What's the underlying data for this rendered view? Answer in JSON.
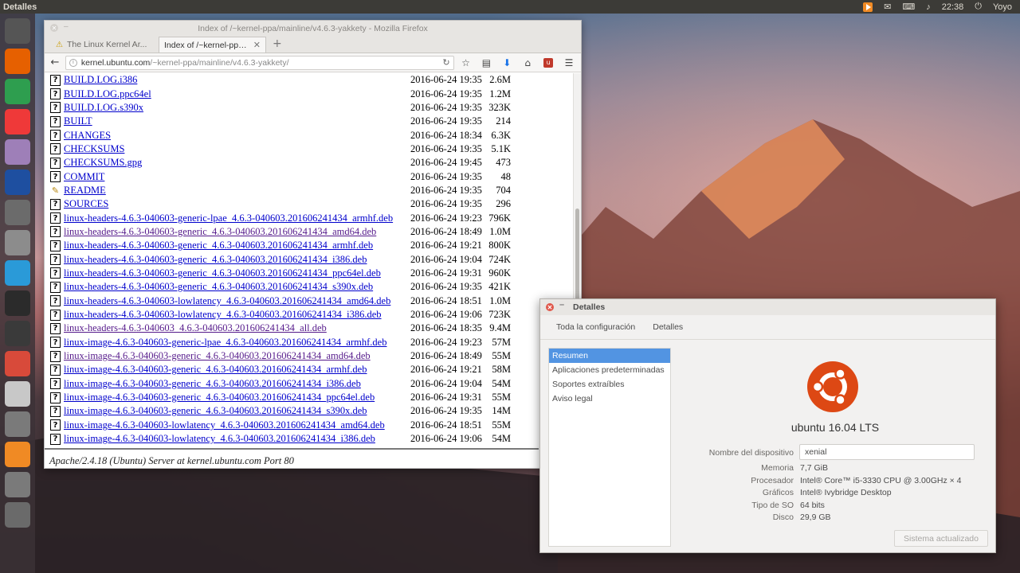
{
  "top_panel": {
    "title": "Detalles",
    "time": "22:38",
    "user": "Yoyo"
  },
  "launcher": {
    "items": [
      {
        "name": "ubuntu-dash",
        "color": "#555555"
      },
      {
        "name": "firefox",
        "color": "#e66000"
      },
      {
        "name": "chrome",
        "color": "#2e9e4f"
      },
      {
        "name": "vivaldi",
        "color": "#ef3939"
      },
      {
        "name": "files",
        "color": "#9e7fb8"
      },
      {
        "name": "audacity",
        "color": "#1e4fa0"
      },
      {
        "name": "terminal-app",
        "color": "#6b6b6b"
      },
      {
        "name": "archive",
        "color": "#8c8c8c"
      },
      {
        "name": "deepin",
        "color": "#2a9ad8"
      },
      {
        "name": "terminal",
        "color": "#2b2b2b"
      },
      {
        "name": "obs",
        "color": "#3a3a3a"
      },
      {
        "name": "downloader",
        "color": "#d84a3a"
      },
      {
        "name": "utility",
        "color": "#c8c8c8"
      },
      {
        "name": "settings",
        "color": "#7a7a7a"
      },
      {
        "name": "vlc",
        "color": "#f08a24"
      },
      {
        "name": "system-settings",
        "color": "#7a7a7a"
      },
      {
        "name": "drive",
        "color": "#6a6a6a"
      }
    ]
  },
  "firefox": {
    "window_title": "Index of /~kernel-ppa/mainline/v4.6.3-yakkety - Mozilla Firefox",
    "tabs": [
      {
        "label": "The Linux Kernel Ar..."
      },
      {
        "label": "Index of /~kernel-ppa/..."
      }
    ],
    "url_host": "kernel.ubuntu.com",
    "url_path": "/~kernel-ppa/mainline/v4.6.3-yakkety/",
    "files": [
      {
        "name": "BUILD.LOG.i386",
        "date": "2016-06-24 19:35",
        "size": "2.6M",
        "visited": false
      },
      {
        "name": "BUILD.LOG.ppc64el",
        "date": "2016-06-24 19:35",
        "size": "1.2M",
        "visited": false
      },
      {
        "name": "BUILD.LOG.s390x",
        "date": "2016-06-24 19:35",
        "size": "323K",
        "visited": false
      },
      {
        "name": "BUILT",
        "date": "2016-06-24 19:35",
        "size": "214",
        "visited": false
      },
      {
        "name": "CHANGES",
        "date": "2016-06-24 18:34",
        "size": "6.3K",
        "visited": false
      },
      {
        "name": "CHECKSUMS",
        "date": "2016-06-24 19:35",
        "size": "5.1K",
        "visited": false
      },
      {
        "name": "CHECKSUMS.gpg",
        "date": "2016-06-24 19:45",
        "size": "473",
        "visited": false
      },
      {
        "name": "COMMIT",
        "date": "2016-06-24 19:35",
        "size": "48",
        "visited": false
      },
      {
        "name": "README",
        "date": "2016-06-24 19:35",
        "size": "704",
        "visited": false,
        "readme": true
      },
      {
        "name": "SOURCES",
        "date": "2016-06-24 19:35",
        "size": "296",
        "visited": false
      },
      {
        "name": "linux-headers-4.6.3-040603-generic-lpae_4.6.3-040603.201606241434_armhf.deb",
        "date": "2016-06-24 19:23",
        "size": "796K",
        "visited": false
      },
      {
        "name": "linux-headers-4.6.3-040603-generic_4.6.3-040603.201606241434_amd64.deb",
        "date": "2016-06-24 18:49",
        "size": "1.0M",
        "visited": true
      },
      {
        "name": "linux-headers-4.6.3-040603-generic_4.6.3-040603.201606241434_armhf.deb",
        "date": "2016-06-24 19:21",
        "size": "800K",
        "visited": false
      },
      {
        "name": "linux-headers-4.6.3-040603-generic_4.6.3-040603.201606241434_i386.deb",
        "date": "2016-06-24 19:04",
        "size": "724K",
        "visited": false
      },
      {
        "name": "linux-headers-4.6.3-040603-generic_4.6.3-040603.201606241434_ppc64el.deb",
        "date": "2016-06-24 19:31",
        "size": "960K",
        "visited": false
      },
      {
        "name": "linux-headers-4.6.3-040603-generic_4.6.3-040603.201606241434_s390x.deb",
        "date": "2016-06-24 19:35",
        "size": "421K",
        "visited": false
      },
      {
        "name": "linux-headers-4.6.3-040603-lowlatency_4.6.3-040603.201606241434_amd64.deb",
        "date": "2016-06-24 18:51",
        "size": "1.0M",
        "visited": false
      },
      {
        "name": "linux-headers-4.6.3-040603-lowlatency_4.6.3-040603.201606241434_i386.deb",
        "date": "2016-06-24 19:06",
        "size": "723K",
        "visited": false
      },
      {
        "name": "linux-headers-4.6.3-040603_4.6.3-040603.201606241434_all.deb",
        "date": "2016-06-24 18:35",
        "size": "9.4M",
        "visited": true
      },
      {
        "name": "linux-image-4.6.3-040603-generic-lpae_4.6.3-040603.201606241434_armhf.deb",
        "date": "2016-06-24 19:23",
        "size": "57M",
        "visited": false
      },
      {
        "name": "linux-image-4.6.3-040603-generic_4.6.3-040603.201606241434_amd64.deb",
        "date": "2016-06-24 18:49",
        "size": "55M",
        "visited": true
      },
      {
        "name": "linux-image-4.6.3-040603-generic_4.6.3-040603.201606241434_armhf.deb",
        "date": "2016-06-24 19:21",
        "size": "58M",
        "visited": false
      },
      {
        "name": "linux-image-4.6.3-040603-generic_4.6.3-040603.201606241434_i386.deb",
        "date": "2016-06-24 19:04",
        "size": "54M",
        "visited": false
      },
      {
        "name": "linux-image-4.6.3-040603-generic_4.6.3-040603.201606241434_ppc64el.deb",
        "date": "2016-06-24 19:31",
        "size": "55M",
        "visited": false
      },
      {
        "name": "linux-image-4.6.3-040603-generic_4.6.3-040603.201606241434_s390x.deb",
        "date": "2016-06-24 19:35",
        "size": "14M",
        "visited": false
      },
      {
        "name": "linux-image-4.6.3-040603-lowlatency_4.6.3-040603.201606241434_amd64.deb",
        "date": "2016-06-24 18:51",
        "size": "55M",
        "visited": false
      },
      {
        "name": "linux-image-4.6.3-040603-lowlatency_4.6.3-040603.201606241434_i386.deb",
        "date": "2016-06-24 19:06",
        "size": "54M",
        "visited": false
      }
    ],
    "server_signature": "Apache/2.4.18 (Ubuntu) Server at kernel.ubuntu.com Port 80"
  },
  "details": {
    "window_title": "Detalles",
    "crumbs": [
      "Toda la configuración",
      "Detalles"
    ],
    "sidebar": [
      "Resumen",
      "Aplicaciones predeterminadas",
      "Soportes extraíbles",
      "Aviso legal"
    ],
    "os_name": "ubuntu 16.04 LTS",
    "device_label": "Nombre del dispositivo",
    "device_value": "xenial",
    "info": [
      {
        "label": "Memoria",
        "value": "7,7 GiB"
      },
      {
        "label": "Procesador",
        "value": "Intel® Core™ i5-3330 CPU @ 3.00GHz × 4"
      },
      {
        "label": "Gráficos",
        "value": "Intel® Ivybridge Desktop"
      },
      {
        "label": "Tipo de SO",
        "value": "64 bits"
      },
      {
        "label": "Disco",
        "value": "29,9 GB"
      }
    ],
    "update_button": "Sistema actualizado",
    "accent": "#dd4814"
  }
}
